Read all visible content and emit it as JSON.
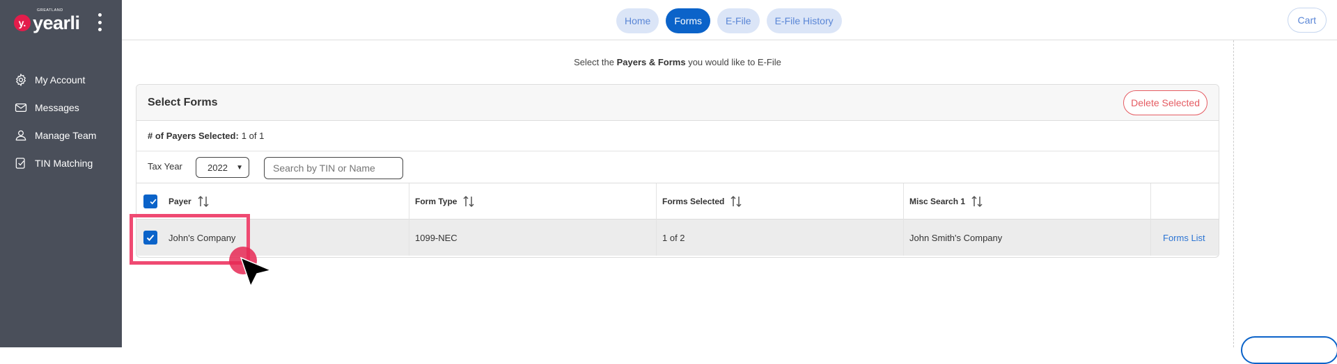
{
  "sidebar": {
    "logo_badge": "y.",
    "logo_sub": "GREATLAND",
    "logo_text": "yearli",
    "items": [
      {
        "label": "My Account",
        "icon": "gear-icon"
      },
      {
        "label": "Messages",
        "icon": "envelope-icon"
      },
      {
        "label": "Manage Team",
        "icon": "user-icon"
      },
      {
        "label": "TIN Matching",
        "icon": "check-doc-icon"
      }
    ]
  },
  "topnav": {
    "tabs": [
      {
        "label": "Home",
        "active": false
      },
      {
        "label": "Forms",
        "active": true
      },
      {
        "label": "E-File",
        "active": false
      },
      {
        "label": "E-File History",
        "active": false
      }
    ],
    "cart_label": "Cart"
  },
  "instruction": {
    "prefix": "Select the ",
    "bold": "Payers & Forms",
    "suffix": " you would like to E-File"
  },
  "card": {
    "title": "Select Forms",
    "delete_label": "Delete Selected",
    "payers_selected_label": "# of Payers Selected:",
    "payers_selected_value": "1 of 1",
    "tax_year_label": "Tax Year",
    "tax_year_value": "2022",
    "search_placeholder": "Search by TIN or Name",
    "columns": [
      "Payer",
      "Form Type",
      "Forms Selected",
      "Misc Search 1"
    ],
    "rows": [
      {
        "payer": "John's Company",
        "form_type": "1099-NEC",
        "forms_selected": "1 of 2",
        "misc_search_1": "John Smith's Company",
        "action": "Forms List",
        "checked": true
      }
    ]
  },
  "colors": {
    "sidebar_bg": "#4a4f5a",
    "accent": "#0b63c9",
    "pill_bg": "#dbe5f7",
    "danger": "#e55b62",
    "highlight": "#ef4a72"
  }
}
